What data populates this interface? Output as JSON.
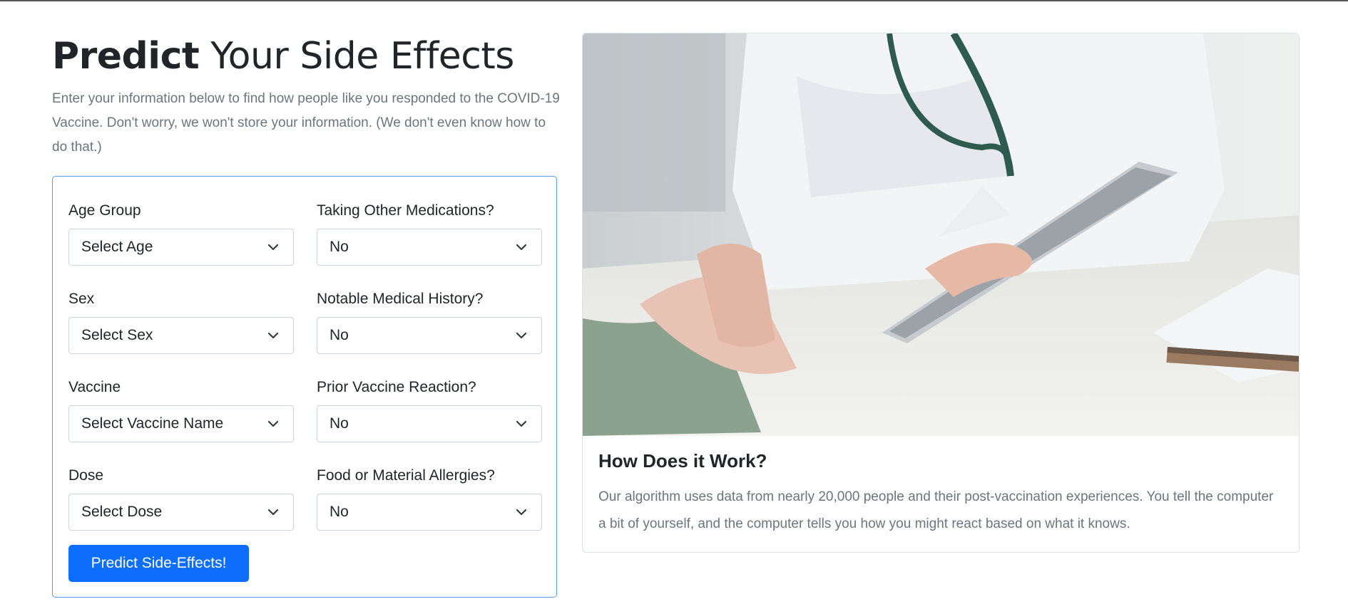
{
  "header": {
    "title_bold": "Predict",
    "title_rest": " Your Side Effects",
    "intro": "Enter your information below to find how people like you responded to the COVID-19 Vaccine. Don't worry, we won't store your information. (We don't even know how to do that.)"
  },
  "form": {
    "age": {
      "label": "Age Group",
      "value": "Select Age"
    },
    "sex": {
      "label": "Sex",
      "value": "Select Sex"
    },
    "vaccine": {
      "label": "Vaccine",
      "value": "Select Vaccine Name"
    },
    "dose": {
      "label": "Dose",
      "value": "Select Dose"
    },
    "medications": {
      "label": "Taking Other Medications?",
      "value": "No"
    },
    "history": {
      "label": "Notable Medical History?",
      "value": "No"
    },
    "prior_reaction": {
      "label": "Prior Vaccine Reaction?",
      "value": "No"
    },
    "allergies": {
      "label": "Food or Material Allergies?",
      "value": "No"
    },
    "submit_label": "Predict Side-Effects!"
  },
  "info_card": {
    "title": "How Does it Work?",
    "text": "Our algorithm uses data from nearly 20,000 people and their post-vaccination experiences. You tell the computer a bit of yourself, and the computer tells you how you might react based on what it knows."
  },
  "colors": {
    "accent": "#0d6efd",
    "card_border": "#5b9bf3",
    "muted_text": "#6c757d"
  },
  "icons": {
    "select_arrow": "chevron-down-icon"
  }
}
